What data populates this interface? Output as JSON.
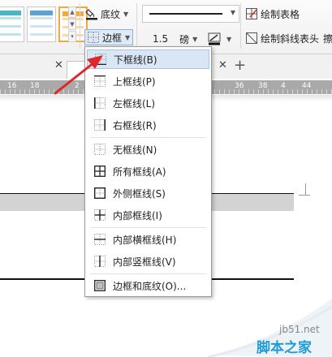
{
  "ribbon": {
    "shading_label": "底纹",
    "border_label": "边框",
    "line_width_value": "1.5",
    "line_width_unit": "磅",
    "draw_table_label": "绘制表格",
    "draw_diagonal_header_label": "绘制斜线表头",
    "cut_off_label": "擦"
  },
  "ruler": {
    "ticks": [
      "16",
      "18",
      "2",
      "36",
      "38",
      "4",
      "44"
    ]
  },
  "border_menu": {
    "items": [
      {
        "label": "下框线(B)",
        "icon": "bottom-border-icon"
      },
      {
        "label": "上框线(P)",
        "icon": "top-border-icon"
      },
      {
        "label": "左框线(L)",
        "icon": "left-border-icon"
      },
      {
        "label": "右框线(R)",
        "icon": "right-border-icon"
      },
      {
        "label": "无框线(N)",
        "icon": "no-border-icon"
      },
      {
        "label": "所有框线(A)",
        "icon": "all-borders-icon"
      },
      {
        "label": "外侧框线(S)",
        "icon": "outside-borders-icon"
      },
      {
        "label": "内部框线(I)",
        "icon": "inside-borders-icon"
      },
      {
        "label": "内部横框线(H)",
        "icon": "inside-horizontal-border-icon"
      },
      {
        "label": "内部竖框线(V)",
        "icon": "inside-vertical-border-icon"
      },
      {
        "label": "边框和底纹(O)...",
        "icon": "borders-and-shading-icon"
      }
    ]
  },
  "watermark": {
    "url": "jb51.net",
    "name": "脚本之家"
  },
  "colors": {
    "highlight": "#d8e6f6",
    "arrow": "#e0262b",
    "style_teal": "#4bb5c8",
    "style_orange": "#f3a93c",
    "watermark_blue": "#1f9bd6"
  }
}
